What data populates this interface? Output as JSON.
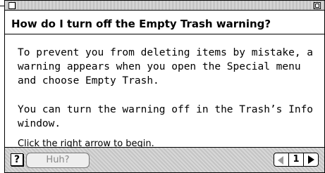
{
  "window": {
    "question": "How do I turn off the Empty Trash warning?"
  },
  "content": {
    "paragraph1": "To prevent you from deleting items by mistake, a warning appears when you open the Special menu and choose Empty Trash.",
    "paragraph2": "You can turn the warning off in the Trash’s Info window.",
    "instruction": "Click the right arrow to begin."
  },
  "bottom": {
    "help_symbol": "?",
    "huh_label": "Huh?",
    "page_number": "1"
  },
  "icons": {
    "close": "close-box-icon",
    "zoom": "zoom-box-icon",
    "prev": "left-arrow-icon",
    "next": "right-arrow-icon",
    "help": "question-icon"
  }
}
